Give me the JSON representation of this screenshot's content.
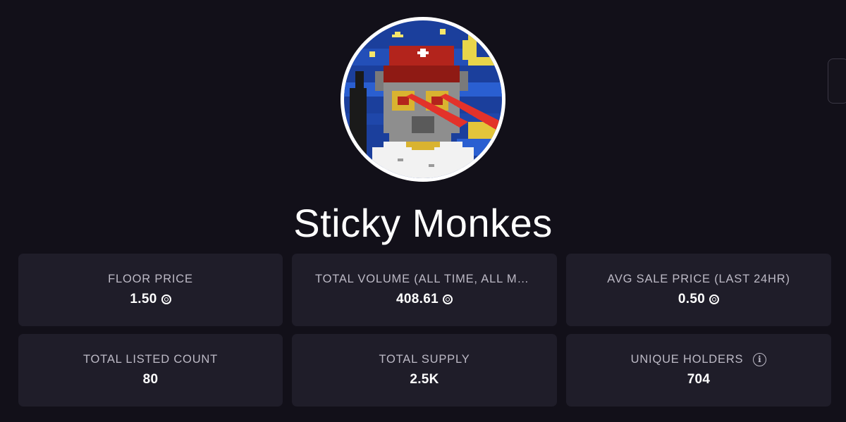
{
  "collection": {
    "name": "Sticky Monkes"
  },
  "stats": [
    {
      "label": "FLOOR PRICE",
      "value": "1.50",
      "icon": "sol-icon"
    },
    {
      "label": "TOTAL VOLUME (ALL TIME, ALL MARKETPLACES)",
      "value": "408.61",
      "icon": "sol-icon"
    },
    {
      "label": "AVG SALE PRICE (LAST 24HR)",
      "value": "0.50",
      "icon": "sol-icon"
    },
    {
      "label": "TOTAL LISTED COUNT",
      "value": "80"
    },
    {
      "label": "TOTAL SUPPLY",
      "value": "2.5K"
    },
    {
      "label": "UNIQUE HOLDERS",
      "value": "704",
      "info_icon": "info-icon"
    }
  ],
  "colors": {
    "background": "#121019",
    "card": "#1f1d29",
    "label": "#bdbac6",
    "value": "#ffffff"
  }
}
